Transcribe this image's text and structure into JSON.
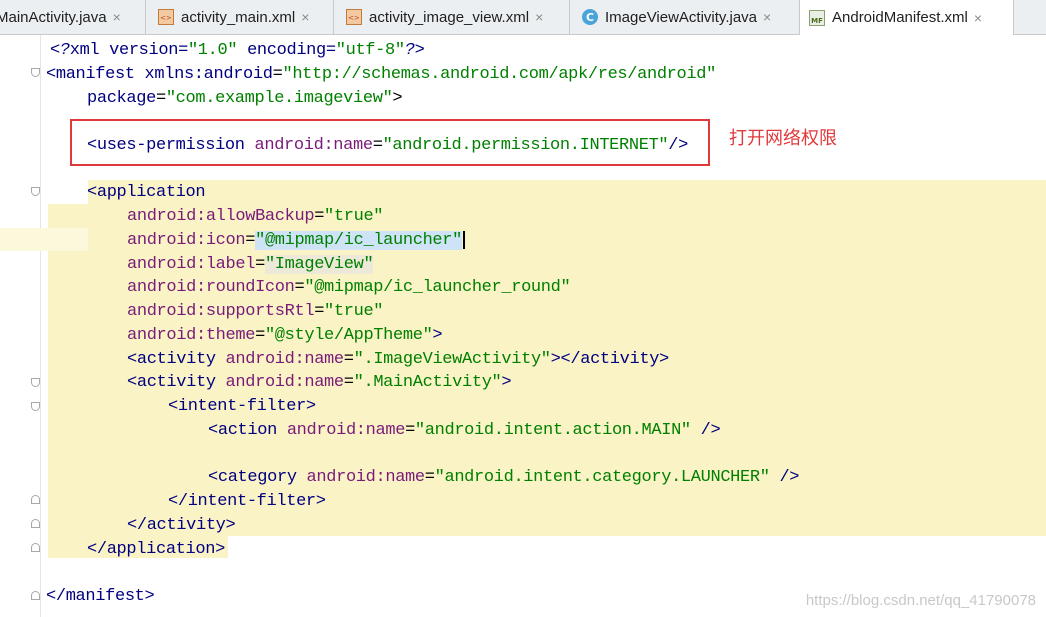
{
  "tabs": [
    {
      "label": "MainActivity.java",
      "icon": "java-class-icon",
      "active": false
    },
    {
      "label": "activity_main.xml",
      "icon": "xml-file-icon",
      "active": false
    },
    {
      "label": "activity_image_view.xml",
      "icon": "xml-file-icon",
      "active": false
    },
    {
      "label": "ImageViewActivity.java",
      "icon": "java-class-icon",
      "active": false
    },
    {
      "label": "AndroidManifest.xml",
      "icon": "manifest-file-icon",
      "active": true
    }
  ],
  "tab_close_glyph": "×",
  "java_icon_letter": "C",
  "manifest_icon_letters": "MF",
  "code": {
    "l1": {
      "a": "<?",
      "b": "xml version=",
      "c": "\"1.0\"",
      "d": " encoding=",
      "e": "\"utf-8\"",
      "f": "?>"
    },
    "l2": {
      "a": "<manifest ",
      "b": "xmlns:android",
      "c": "=",
      "d": "\"http://schemas.android.com/apk/res/android\""
    },
    "l3": {
      "a": "package",
      "b": "=",
      "c": "\"com.example.imageview\"",
      "d": ">"
    },
    "l5": {
      "a": "<uses-permission ",
      "b": "android:name",
      "c": "=",
      "d": "\"android.permission.INTERNET\"",
      "e": "/>"
    },
    "l7": {
      "a": "<application"
    },
    "l8": {
      "a": "android:allowBackup",
      "b": "=",
      "c": "\"true\""
    },
    "l9": {
      "a": "android:icon",
      "b": "=",
      "c": "\"@mipmap/ic_launcher\""
    },
    "l10": {
      "a": "android:label",
      "b": "=",
      "c": "\"ImageView\""
    },
    "l11": {
      "a": "android:roundIcon",
      "b": "=",
      "c": "\"@mipmap/ic_launcher_round\""
    },
    "l12": {
      "a": "android:supportsRtl",
      "b": "=",
      "c": "\"true\""
    },
    "l13": {
      "a": "android:theme",
      "b": "=",
      "c": "\"@style/AppTheme\"",
      "d": ">"
    },
    "l14": {
      "a": "<activity ",
      "b": "android:name",
      "c": "=",
      "d": "\".ImageViewActivity\"",
      "e": "></activity>"
    },
    "l15": {
      "a": "<activity ",
      "b": "android:name",
      "c": "=",
      "d": "\".MainActivity\"",
      "e": ">"
    },
    "l16": {
      "a": "<intent-filter>"
    },
    "l17": {
      "a": "<action ",
      "b": "android:name",
      "c": "=",
      "d": "\"android.intent.action.MAIN\"",
      "e": " />"
    },
    "l19": {
      "a": "<category ",
      "b": "android:name",
      "c": "=",
      "d": "\"android.intent.category.LAUNCHER\"",
      "e": " />"
    },
    "l20": {
      "a": "</intent-filter>"
    },
    "l21": {
      "a": "</activity>"
    },
    "l22": {
      "a": "</application>"
    },
    "l24": {
      "a": "</manifest>"
    }
  },
  "annotation": "打开网络权限",
  "watermark": "https://blog.csdn.net/qq_41790078"
}
